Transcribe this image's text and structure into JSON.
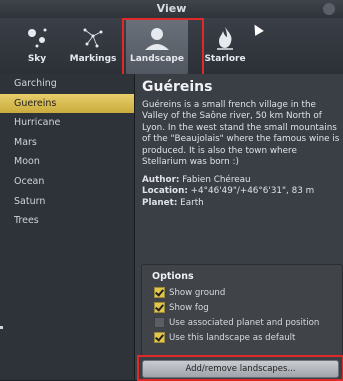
{
  "window": {
    "title": "View"
  },
  "tabs": [
    {
      "label": "Sky",
      "icon": "sky-icon"
    },
    {
      "label": "Markings",
      "icon": "markings-icon"
    },
    {
      "label": "Landscape",
      "icon": "landscape-icon",
      "active": true
    },
    {
      "label": "Starlore",
      "icon": "starlore-icon"
    }
  ],
  "landscapes": [
    "Garching",
    "Guereins",
    "Hurricane",
    "Mars",
    "Moon",
    "Ocean",
    "Saturn",
    "Trees"
  ],
  "selected_landscape": "Guereins",
  "description": {
    "title": "Guéreins",
    "body": "Guéreins is a small french village in the Valley of the Saône river, 50 km North of Lyon. In the west stand the small mountains of the \"Beaujolais\" where the famous wine is produced. It is also the town where Stellarium was born :)",
    "author_label": "Author:",
    "author_value": "Fabien Chéreau",
    "location_label": "Location:",
    "location_value": "+4°46'49\"/+46°6'31\", 83 m",
    "planet_label": "Planet:",
    "planet_value": "Earth"
  },
  "options": {
    "title": "Options",
    "items": [
      {
        "label": "Show ground",
        "checked": true
      },
      {
        "label": "Show fog",
        "checked": true
      },
      {
        "label": "Use associated planet and position",
        "checked": false
      },
      {
        "label": "Use this landscape as default",
        "checked": true
      }
    ]
  },
  "add_remove_button": "Add/remove landscapes...",
  "colors": {
    "highlight": "#d9bd4e",
    "annotation_red": "#e02a2a"
  }
}
